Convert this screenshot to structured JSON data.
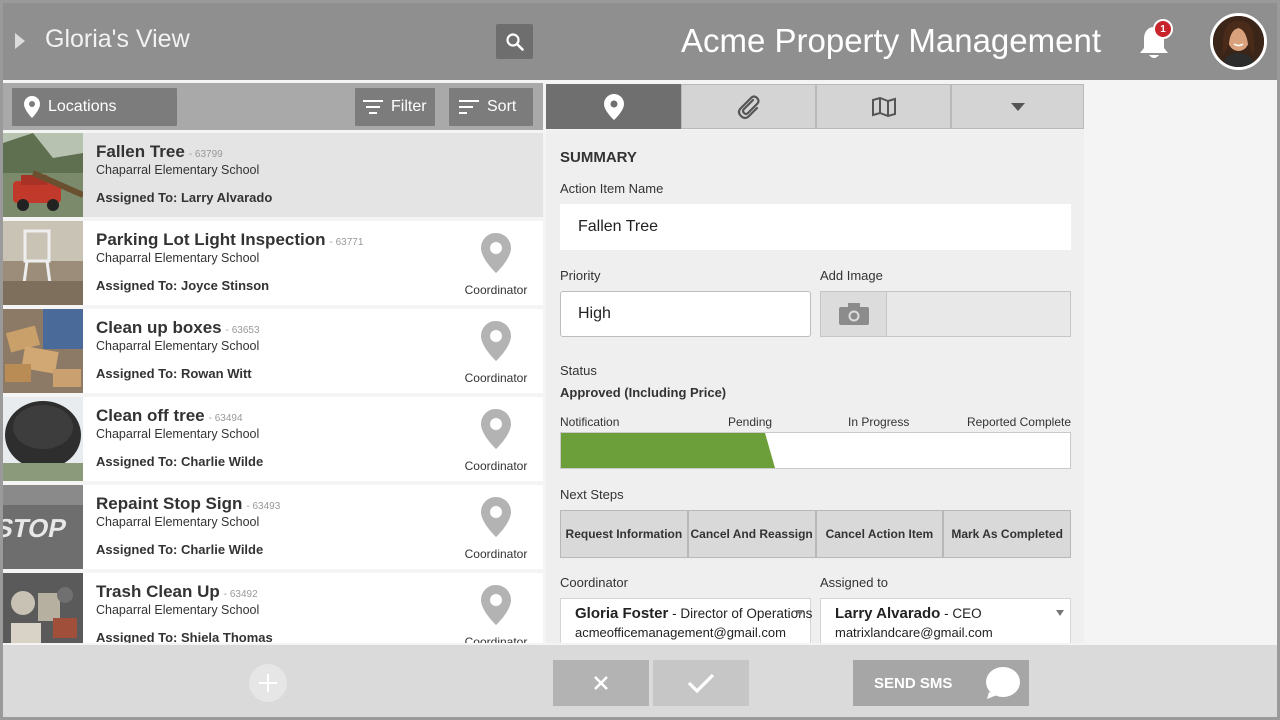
{
  "header": {
    "view_title": "Gloria's View",
    "app_title": "Acme Property Management",
    "notification_count": "1"
  },
  "toolbar": {
    "locations_label": "Locations",
    "filter_label": "Filter",
    "sort_label": "Sort"
  },
  "items": [
    {
      "title": "Fallen Tree",
      "id": "- 63799",
      "location": "Chaparral Elementary School",
      "assigned": "Assigned To: Larry Alvarado",
      "role": "",
      "selected": true
    },
    {
      "title": "Parking Lot Light Inspection",
      "id": "- 63771",
      "location": "Chaparral Elementary School",
      "assigned": "Assigned To: Joyce Stinson",
      "role": "Coordinator"
    },
    {
      "title": "Clean up boxes",
      "id": "- 63653",
      "location": "Chaparral Elementary School",
      "assigned": "Assigned To: Rowan Witt",
      "role": "Coordinator"
    },
    {
      "title": "Clean off tree",
      "id": "- 63494",
      "location": "Chaparral Elementary School",
      "assigned": "Assigned To: Charlie Wilde",
      "role": "Coordinator"
    },
    {
      "title": "Repaint Stop Sign",
      "id": "- 63493",
      "location": "Chaparral Elementary School",
      "assigned": "Assigned To: Charlie Wilde",
      "role": "Coordinator"
    },
    {
      "title": "Trash Clean Up",
      "id": "- 63492",
      "location": "Chaparral Elementary School",
      "assigned": "Assigned To: Shiela Thomas",
      "role": "Coordinator"
    }
  ],
  "detail": {
    "section_title": "SUMMARY",
    "name_label": "Action Item Name",
    "name_value": "Fallen Tree",
    "priority_label": "Priority",
    "priority_value": "High",
    "image_label": "Add Image",
    "status_label": "Status",
    "status_value": "Approved (Including Price)",
    "progress_stages": [
      "Notification",
      "Pending",
      "In Progress",
      "Reported Complete"
    ],
    "progress_fraction": 0.4,
    "next_steps_label": "Next Steps",
    "next_steps": [
      "Request Information",
      "Cancel And Reassign",
      "Cancel Action Item",
      "Mark As Completed"
    ],
    "coordinator_label": "Coordinator",
    "coordinator": {
      "name": "Gloria Foster",
      "role": " - Director of Operations",
      "email": "acmeofficemanagement@gmail.com"
    },
    "assigned_label": "Assigned to",
    "assignee": {
      "name": "Larry Alvarado",
      "role": " - CEO",
      "email": "matrixlandcare@gmail.com"
    }
  },
  "footer": {
    "sms_label": "SEND SMS"
  },
  "colors": {
    "progress_fill": "#6c9e3a",
    "badge": "#c8242b",
    "header_bg": "#8f8f8f"
  }
}
